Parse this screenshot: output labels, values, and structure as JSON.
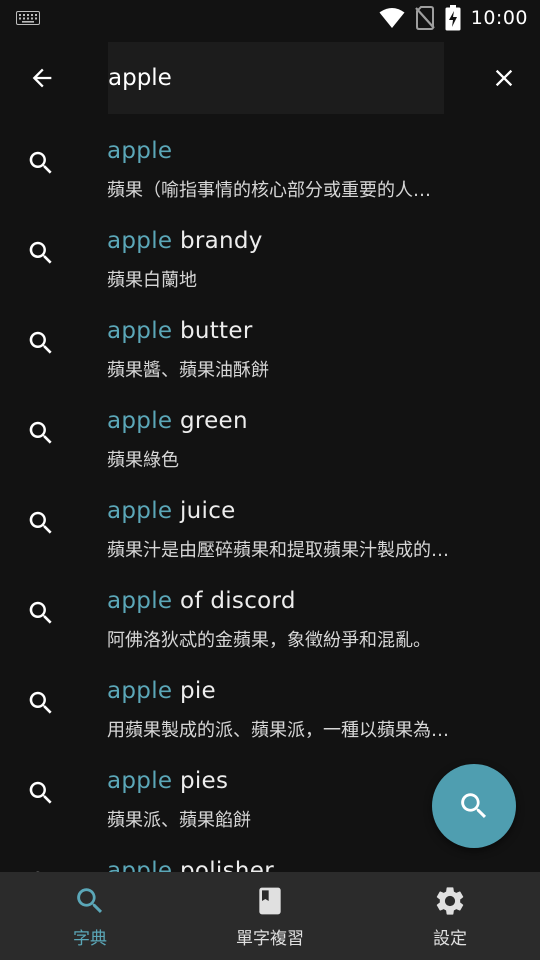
{
  "colors": {
    "accent": "#5ba7b8",
    "fab": "#4f9eb0",
    "background": "#121212",
    "nav_background": "#2b2b2b"
  },
  "status_bar": {
    "time": "10:00",
    "icons": [
      "keyboard-icon",
      "wifi-icon",
      "no-sim-icon",
      "battery-charging-icon"
    ]
  },
  "search": {
    "value": "apple",
    "back_icon": "arrow-left-icon",
    "clear_icon": "close-icon"
  },
  "results": [
    {
      "match": "apple",
      "rest": "",
      "definition": "蘋果（喻指事情的核心部分或重要的人…"
    },
    {
      "match": "apple",
      "rest": " brandy",
      "definition": "蘋果白蘭地"
    },
    {
      "match": "apple",
      "rest": " butter",
      "definition": "蘋果醬、蘋果油酥餅"
    },
    {
      "match": "apple",
      "rest": " green",
      "definition": "蘋果綠色"
    },
    {
      "match": "apple",
      "rest": " juice",
      "definition": "蘋果汁是由壓碎蘋果和提取蘋果汁製成的…"
    },
    {
      "match": "apple",
      "rest": " of discord",
      "definition": "阿佛洛狄忒的金蘋果，象徵紛爭和混亂。"
    },
    {
      "match": "apple",
      "rest": " pie",
      "definition": "用蘋果製成的派、蘋果派，一種以蘋果為…"
    },
    {
      "match": "apple",
      "rest": " pies",
      "definition": "蘋果派、蘋果餡餅"
    },
    {
      "match": "apple",
      "rest": " polisher",
      "definition": ""
    }
  ],
  "fab": {
    "icon": "search-icon"
  },
  "bottom_nav": [
    {
      "label": "字典",
      "icon": "search-icon",
      "active": true
    },
    {
      "label": "單字複習",
      "icon": "book-icon",
      "active": false
    },
    {
      "label": "設定",
      "icon": "gear-icon",
      "active": false
    }
  ]
}
